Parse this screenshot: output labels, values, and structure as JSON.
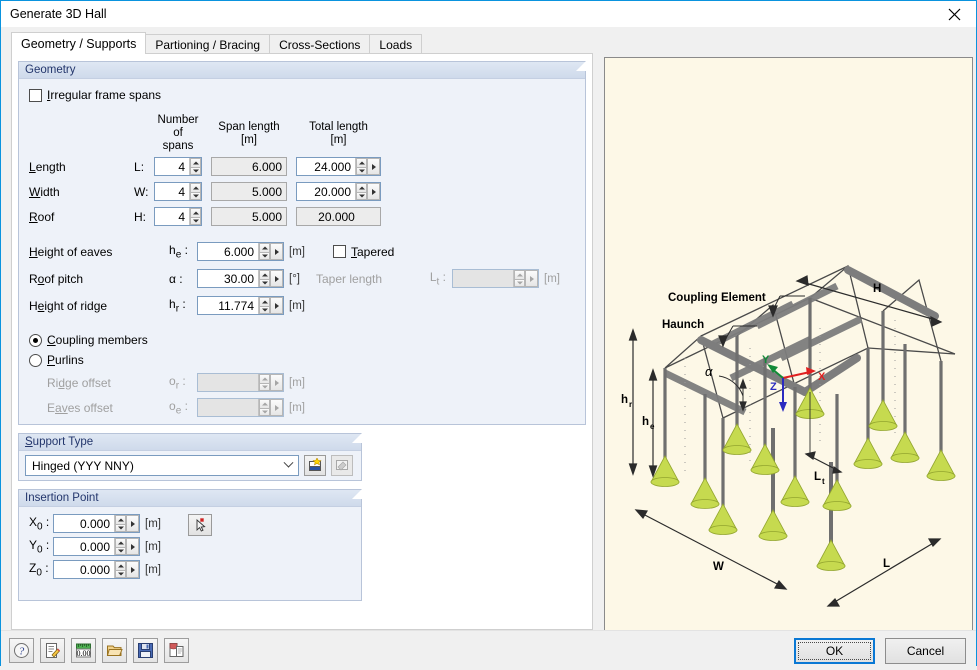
{
  "window": {
    "title": "Generate 3D Hall",
    "close_icon": "close-icon"
  },
  "tabs": [
    {
      "label": "Geometry / Supports",
      "active": true
    },
    {
      "label": "Partioning / Bracing",
      "active": false
    },
    {
      "label": "Cross-Sections",
      "active": false
    },
    {
      "label": "Loads",
      "active": false
    }
  ],
  "geometry": {
    "group_title": "Geometry",
    "irregular_checkbox": {
      "label": "Irregular frame spans",
      "checked": false,
      "accesskey": "I"
    },
    "columns": {
      "number_of_spans": "Number of\nspans",
      "number_of_spans_line1": "Number of",
      "number_of_spans_line2": "spans",
      "span_length_line1": "Span length",
      "span_length_line2": "[m]",
      "total_length_line1": "Total length",
      "total_length_line2": "[m]"
    },
    "rows": [
      {
        "name": "Length",
        "symbol": "L",
        "spans": "4",
        "span_length": "6.000",
        "total_length": "24.000",
        "total_editable": true
      },
      {
        "name": "Width",
        "symbol": "W",
        "spans": "4",
        "span_length": "5.000",
        "total_length": "20.000",
        "total_editable": true
      },
      {
        "name": "Roof",
        "symbol": "H",
        "spans": "4",
        "span_length": "5.000",
        "total_length": "20.000",
        "total_editable": false
      }
    ],
    "eaves": {
      "label": "Height of eaves",
      "symbol": "h",
      "sub": "e",
      "value": "6.000",
      "unit": "[m]"
    },
    "pitch": {
      "label": "Roof pitch",
      "symbol": "α",
      "sub": "",
      "value": "30.00",
      "unit": "[°]"
    },
    "ridge": {
      "label": "Height of ridge",
      "symbol": "h",
      "sub": "r",
      "value": "11.774",
      "unit": "[m]"
    },
    "tapered": {
      "label": "Tapered",
      "checked": false
    },
    "taper_length": {
      "label": "Taper length",
      "symbol": "L",
      "sub": "t",
      "value": "",
      "unit": "[m]",
      "enabled": false
    },
    "coupling_members": {
      "label": "Coupling members",
      "selected": true
    },
    "purlins": {
      "label": "Purlins",
      "selected": false
    },
    "ridge_offset": {
      "label": "Ridge offset",
      "symbol": "o",
      "sub": "r",
      "value": "",
      "unit": "[m]",
      "enabled": false
    },
    "eaves_offset": {
      "label": "Eaves offset",
      "symbol": "o",
      "sub": "e",
      "value": "",
      "unit": "[m]",
      "enabled": false
    }
  },
  "support_type": {
    "group_title": "Support Type",
    "selected": "Hinged (YYY NNY)",
    "options": [
      "Hinged (YYY NNY)"
    ],
    "new_button_icon": "new-support-icon",
    "edit_button_icon": "edit-support-icon"
  },
  "insertion_point": {
    "group_title": "Insertion Point",
    "fields": [
      {
        "symbol": "X",
        "sub": "0",
        "value": "0.000",
        "unit": "[m]"
      },
      {
        "symbol": "Y",
        "sub": "0",
        "value": "0.000",
        "unit": "[m]"
      },
      {
        "symbol": "Z",
        "sub": "0",
        "value": "0.000",
        "unit": "[m]"
      }
    ],
    "pick_button_icon": "pick-point-icon"
  },
  "view3d": {
    "background": "#fdf8e7",
    "annotations": [
      "Coupling Element",
      "Haunch",
      "H",
      "h",
      "r",
      "e",
      "α",
      "L",
      "t",
      "W",
      "X",
      "Y",
      "Z"
    ],
    "labels": {
      "coupling_element": "Coupling Element",
      "haunch": "Haunch",
      "height_roof": "H",
      "ridge": "h",
      "ridge_sub": "r",
      "eaves": "h",
      "eaves_sub": "e",
      "alpha": "α",
      "taper": "L",
      "taper_sub": "t",
      "length": "L",
      "width": "W",
      "axis_x": "X",
      "axis_y": "Y",
      "axis_z": "Z"
    },
    "colors": {
      "member": "#767676",
      "support": "#c6da4f",
      "x_axis": "#e02020",
      "y_axis": "#138a38",
      "z_axis": "#2b2bc0"
    }
  },
  "footer": {
    "tools": [
      {
        "name": "help-icon",
        "title": "Help"
      },
      {
        "name": "edit-icon",
        "title": "Edit"
      },
      {
        "name": "units-icon",
        "title": "Units and Decimal Places"
      },
      {
        "name": "open-icon",
        "title": "Open"
      },
      {
        "name": "save-icon",
        "title": "Save"
      },
      {
        "name": "info-icon",
        "title": "Info"
      }
    ],
    "ok_label": "OK",
    "cancel_label": "Cancel"
  }
}
